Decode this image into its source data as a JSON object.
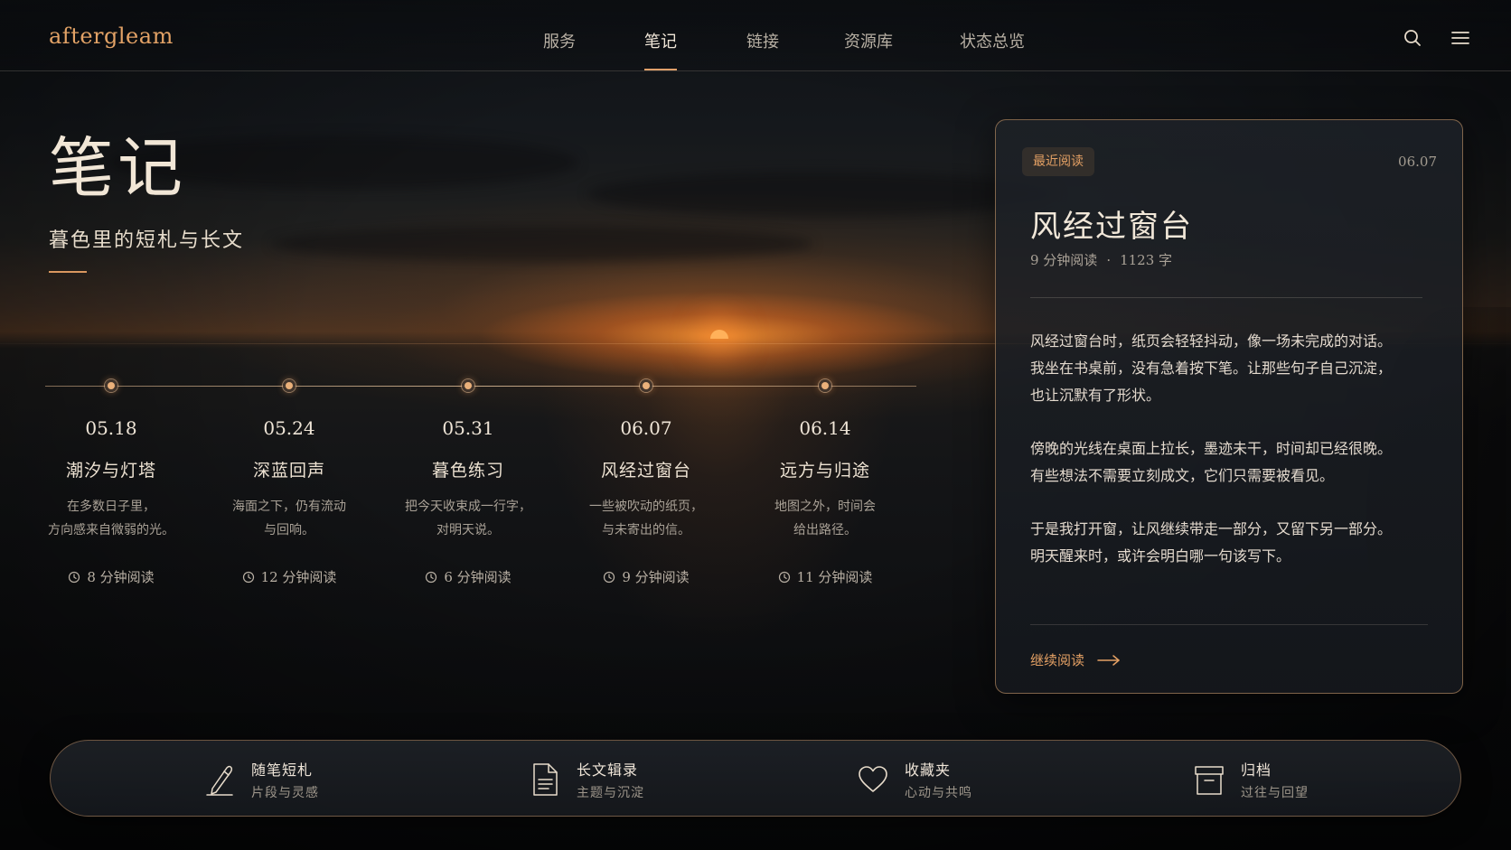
{
  "app": {
    "logo": "aftergleam"
  },
  "nav": {
    "items": [
      {
        "label": "服务",
        "active": false
      },
      {
        "label": "笔记",
        "active": true
      },
      {
        "label": "链接",
        "active": false
      },
      {
        "label": "资源库",
        "active": false
      },
      {
        "label": "状态总览",
        "active": false
      }
    ],
    "search_icon": "search-icon",
    "menu_icon": "menu-icon"
  },
  "hero": {
    "title": "笔记",
    "subtitle": "暮色里的短札与长文"
  },
  "timeline": {
    "entries": [
      {
        "date": "05.18",
        "title": "潮汐与灯塔",
        "desc_line1": "在多数日子里，",
        "desc_line2": "方向感来自微弱的光。",
        "reading": "8 分钟阅读"
      },
      {
        "date": "05.24",
        "title": "深蓝回声",
        "desc_line1": "海面之下，仍有流动",
        "desc_line2": "与回响。",
        "reading": "12 分钟阅读"
      },
      {
        "date": "05.31",
        "title": "暮色练习",
        "desc_line1": "把今天收束成一行字，",
        "desc_line2": "对明天说。",
        "reading": "6 分钟阅读"
      },
      {
        "date": "06.07",
        "title": "风经过窗台",
        "desc_line1": "一些被吹动的纸页，",
        "desc_line2": "与未寄出的信。",
        "reading": "9 分钟阅读"
      },
      {
        "date": "06.14",
        "title": "远方与归途",
        "desc_line1": "地图之外，时间会",
        "desc_line2": "给出路径。",
        "reading": "11 分钟阅读"
      }
    ]
  },
  "reading_card": {
    "badge": "最近阅读",
    "date": "06.07",
    "title": "风经过窗台",
    "reading_time": "9 分钟阅读",
    "separator": "·",
    "word_count": "1123 字",
    "paragraphs": [
      [
        "风经过窗台时，纸页会轻轻抖动，像一场未完成的对话。",
        "我坐在书桌前，没有急着按下笔。让那些句子自己沉淀，",
        "也让沉默有了形状。"
      ],
      [
        "傍晚的光线在桌面上拉长，墨迹未干，时间却已经很晚。",
        "有些想法不需要立刻成文，它们只需要被看见。"
      ],
      [
        "于是我打开窗，让风继续带走一部分，又留下另一部分。",
        "明天醒来时，或许会明白哪一句该写下。"
      ]
    ],
    "cta": "继续阅读"
  },
  "categories": [
    {
      "label": "随笔短札",
      "sub": "片段与灵感",
      "icon": "pen-icon"
    },
    {
      "label": "长文辑录",
      "sub": "主题与沉淀",
      "icon": "document-icon"
    },
    {
      "label": "收藏夹",
      "sub": "心动与共鸣",
      "icon": "heart-icon"
    },
    {
      "label": "归档",
      "sub": "过往与回望",
      "icon": "archive-box-icon"
    }
  ],
  "colors": {
    "accent": "#e3a064",
    "text_primary": "#f1e6d6",
    "text_muted": "#a9a196"
  }
}
